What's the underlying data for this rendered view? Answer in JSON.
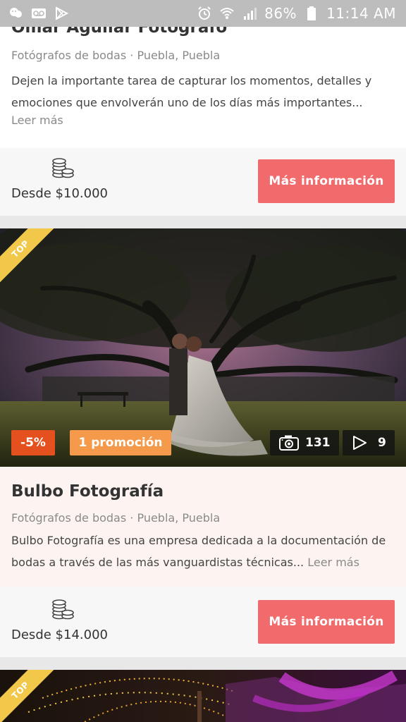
{
  "status_bar": {
    "icons_left": [
      "chat-bubble-icon",
      "voicemail-icon",
      "play-store-icon"
    ],
    "icons_right": [
      "alarm-icon",
      "wifi-icon",
      "signal-icon",
      "battery-icon"
    ],
    "battery": "86%",
    "time": "11:14 AM"
  },
  "listings": [
    {
      "name": "Omar Aguilar Fotógrafo",
      "category_location": "Fotógrafos de bodas · Puebla, Puebla",
      "description": "Dejen la importante tarea de capturar los momentos, detalles y emociones que envolverán uno de los días más importantes...",
      "read_more": "Leer más",
      "price": "Desde $10.000",
      "price_icon": "coins-icon",
      "cta": "Más información"
    },
    {
      "top_label": "TOP",
      "discount": "-5%",
      "promotion": "1 promoción",
      "photos_count": "131",
      "videos_count": "9",
      "name": "Bulbo Fotografía",
      "category_location": "Fotógrafos de bodas · Puebla, Puebla",
      "description": "Bulbo Fotografía es una empresa dedicada a la documentación de bodas a través de las más vanguardistas técnicas...",
      "read_more": "Leer más",
      "price": "Desde $14.000",
      "price_icon": "coins-icon",
      "cta": "Más información"
    },
    {
      "top_label": "TOP"
    }
  ],
  "colors": {
    "status_bar": "#bdbdbd",
    "cta_button": "#f16a6c",
    "discount_badge": "#e4501e",
    "promo_badge": "#f49a4a",
    "top_ribbon": "#f1c84a"
  }
}
